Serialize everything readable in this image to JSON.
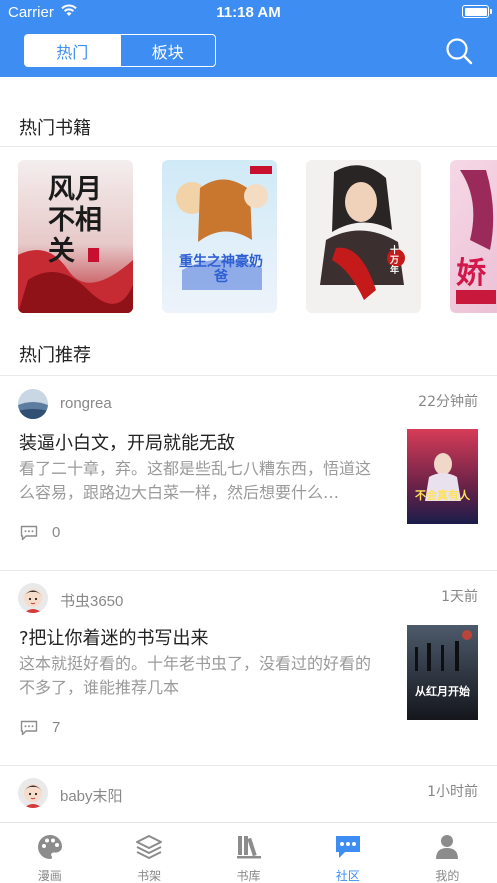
{
  "status_bar": {
    "carrier": "Carrier",
    "time": "11:18 AM"
  },
  "header": {
    "segments": [
      {
        "label": "热门",
        "active": true
      },
      {
        "label": "板块",
        "active": false
      }
    ],
    "search_icon": "search-icon"
  },
  "hot_books": {
    "title": "热门书籍",
    "books": [
      {
        "cover_text": "风月不相关"
      },
      {
        "cover_text": "重生之神豪奶爸"
      },
      {
        "cover_text": "十万年"
      },
      {
        "cover_text": "娇"
      }
    ]
  },
  "recommend": {
    "title": "热门推荐",
    "posts": [
      {
        "user": "rongrea",
        "time": "22分钟前",
        "title": "装逼小白文，开局就能无敌",
        "excerpt": "看了二十章，弃。这都是些乱七八糟东西，悟道这么容易，跟路边大白菜一样，然后想要什么…",
        "comments": "0",
        "cover_text": "不会真有人"
      },
      {
        "user": "书虫3650",
        "time": "1天前",
        "title": "?把让你着迷的书写出来",
        "excerpt": "这本就挺好看的。十年老书虫了，没看过的好看的不多了，谁能推荐几本",
        "comments": "7",
        "cover_text": "从红月开始"
      },
      {
        "user": "baby末阳",
        "time": "1小时前"
      }
    ]
  },
  "tabbar": {
    "items": [
      {
        "label": "漫画",
        "icon": "palette-icon",
        "active": false
      },
      {
        "label": "书架",
        "icon": "layers-icon",
        "active": false
      },
      {
        "label": "书库",
        "icon": "library-icon",
        "active": false
      },
      {
        "label": "社区",
        "icon": "chat-icon",
        "active": true
      },
      {
        "label": "我的",
        "icon": "person-icon",
        "active": false
      }
    ]
  },
  "colors": {
    "brand": "#3d8df2",
    "tab_inactive": "#888888",
    "text": "#222222",
    "muted": "#9a9a9a"
  }
}
